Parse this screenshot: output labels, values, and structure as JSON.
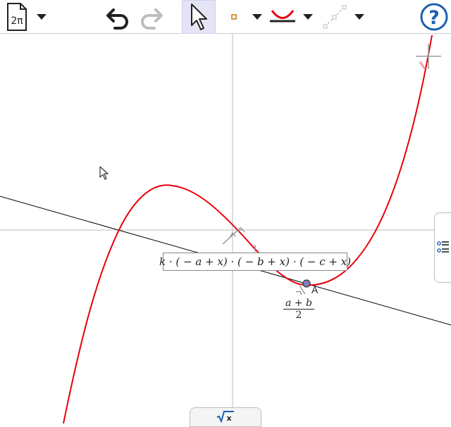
{
  "toolbar": {
    "file_menu_icon_label": "2π",
    "icons": {
      "file": "file-menu-icon",
      "undo": "undo-icon",
      "redo": "redo-icon",
      "move": "move-tool-icon",
      "point": "point-tool-icon",
      "curve": "function-tool-icon",
      "line": "line-tool-icon",
      "help": "help-icon"
    },
    "help_label": "?",
    "redo_enabled": false,
    "active_tool": "move"
  },
  "graphics": {
    "formula": "k · ( − a + x) · ( − b + x) · ( − c + x)",
    "fraction_numerator": "a + b",
    "fraction_denominator": "2",
    "point_label": "A",
    "curve_color": "#e8000b",
    "line_color": "#000000",
    "axis_color": "#bbbbbb",
    "point_fill": "#7f7fbf"
  },
  "algebra_tab": {
    "icon": "algebra-view-icon"
  },
  "input_bar": {
    "icon": "sqrt-x-icon",
    "label": "x"
  }
}
